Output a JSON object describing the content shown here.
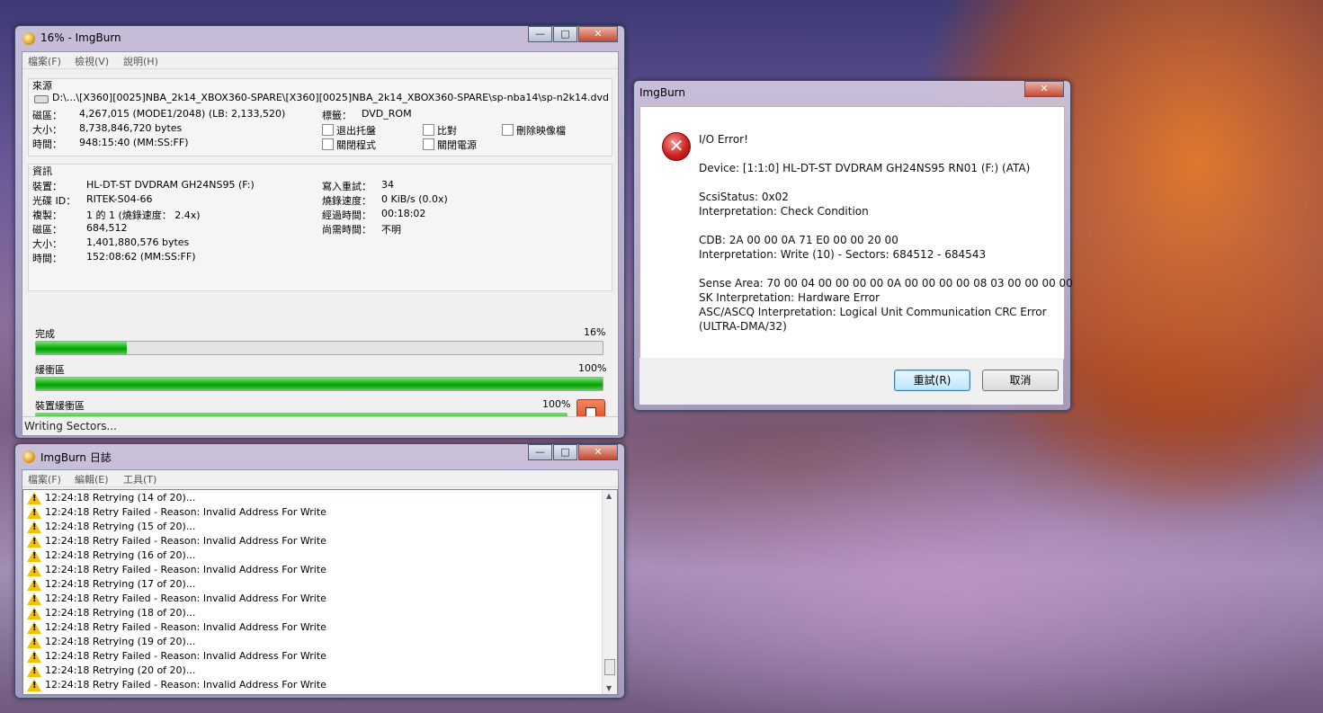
{
  "main_window": {
    "title": "16% - ImgBurn",
    "menu": [
      "檔案(F)",
      "檢視(V)",
      "說明(H)"
    ],
    "source": {
      "heading": "來源",
      "path": "D:\\...\\[X360][0025]NBA_2k14_XBOX360-SPARE\\[X360][0025]NBA_2k14_XBOX360-SPARE\\sp-nba14\\sp-n2k14.dvd",
      "sectors_label": "磁區：",
      "sectors_value": "4,267,015 (MODE1/2048) (LB: 2,133,520)",
      "size_label": "大小：",
      "size_value": "8,738,846,720 bytes",
      "time_label": "時間：",
      "time_value": "948:15:40 (MM:SS:FF)",
      "label_label": "標籤：",
      "label_value": "DVD_ROM",
      "checkboxes": [
        "退出托盤",
        "比對",
        "刪除映像檔",
        "關閉程式",
        "關閉電源"
      ]
    },
    "info": {
      "heading": "資訊",
      "device_label": "裝置：",
      "device_value": "HL-DT-ST DVDRAM GH24NS95 (F:)",
      "disc_id_label": "光碟 ID：",
      "disc_id_value": "RITEK-S04-66",
      "copy_label": "複製：",
      "copy_value": "1 的 1 (燒錄速度： 2.4x)",
      "sectors_label": "磁區：",
      "sectors_value": "684,512",
      "size_label": "大小：",
      "size_value": "1,401,880,576 bytes",
      "time_label": "時間：",
      "time_value": "152:08:62 (MM:SS:FF)",
      "retries_label": "寫入重試：",
      "retries_value": "34",
      "speed_label": "燒錄速度：",
      "speed_value": "0 KiB/s (0.0x)",
      "elapsed_label": "經過時間：",
      "elapsed_value": "00:18:02",
      "remaining_label": "尚需時間：",
      "remaining_value": "不明"
    },
    "progress": [
      {
        "label": "完成",
        "percent_text": "16%",
        "value": 0.16
      },
      {
        "label": "緩衝區",
        "percent_text": "100%",
        "value": 1.0
      },
      {
        "label": "裝置緩衝區",
        "percent_text": "100%",
        "value": 1.0
      }
    ],
    "status": "Writing Sectors..."
  },
  "log_window": {
    "title": "ImgBurn 日誌",
    "menu": [
      "檔案(F)",
      "編輯(E)",
      "工具(T)"
    ],
    "entries": [
      "12:24:18 Retrying (14 of 20)...",
      "12:24:18 Retry Failed - Reason: Invalid Address For Write",
      "12:24:18 Retrying (15 of 20)...",
      "12:24:18 Retry Failed - Reason: Invalid Address For Write",
      "12:24:18 Retrying (16 of 20)...",
      "12:24:18 Retry Failed - Reason: Invalid Address For Write",
      "12:24:18 Retrying (17 of 20)...",
      "12:24:18 Retry Failed - Reason: Invalid Address For Write",
      "12:24:18 Retrying (18 of 20)...",
      "12:24:18 Retry Failed - Reason: Invalid Address For Write",
      "12:24:18 Retrying (19 of 20)...",
      "12:24:18 Retry Failed - Reason: Invalid Address For Write",
      "12:24:18 Retrying (20 of 20)...",
      "12:24:18 Retry Failed - Reason: Invalid Address For Write"
    ]
  },
  "dialog": {
    "title": "ImgBurn",
    "lines": [
      "I/O Error!",
      "Device: [1:1:0] HL-DT-ST DVDRAM GH24NS95 RN01 (F:) (ATA)",
      "ScsiStatus: 0x02",
      "Interpretation: Check Condition",
      "CDB: 2A 00 00 0A 71 E0 00 00 20 00",
      "Interpretation: Write (10) - Sectors: 684512 - 684543",
      "Sense Area: 70 00 04 00 00 00 00 0A 00 00 00 00 08 03 00 00 00 00",
      "SK Interpretation: Hardware Error",
      "ASC/ASCQ Interpretation: Logical Unit Communication CRC Error",
      "(ULTRA-DMA/32)"
    ],
    "retry_button": "重試(R)",
    "cancel_button": "取消"
  }
}
